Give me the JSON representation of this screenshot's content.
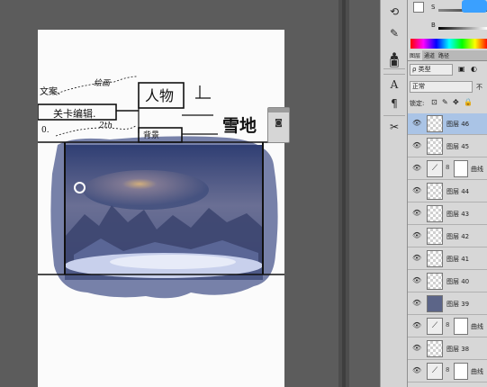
{
  "canvas": {
    "annotations": {
      "wenan": "文案.",
      "huihua": "绘画",
      "renwu": "人物",
      "guanqia": "关卡编辑.",
      "beijing": "背景",
      "o_mark": "0.",
      "num_2": "2th",
      "xuedi": "雪地"
    }
  },
  "toolbar": {
    "icons": [
      "history-icon",
      "brush-presets-icon",
      "clone-source-icon",
      "tool-presets-icon",
      "character-icon",
      "paragraph-icon",
      "tools-icon"
    ]
  },
  "colors": {
    "accent": "#aac4e6",
    "canvas_bg": "#5c5c5c",
    "doc_bg": "#fbfbfb",
    "scene_blue": "#5f6b9a"
  },
  "color_panel": {
    "channel_s_label": "S",
    "channel_b_label": "B"
  },
  "layers_panel": {
    "tabs": [
      "图层",
      "通道",
      "路径"
    ],
    "filter_label": "ρ 类型",
    "blend_mode": "正常",
    "opacity_label": "不",
    "lock_label": "锁定:",
    "layers": [
      {
        "name": "图层 46",
        "kind": "pixel",
        "selected": true
      },
      {
        "name": "图层 45",
        "kind": "pixel"
      },
      {
        "name": "曲线",
        "kind": "adjustment"
      },
      {
        "name": "图层 44",
        "kind": "pixel"
      },
      {
        "name": "图层 43",
        "kind": "pixel"
      },
      {
        "name": "图层 42",
        "kind": "pixel"
      },
      {
        "name": "图层 41",
        "kind": "pixel"
      },
      {
        "name": "图层 40",
        "kind": "pixel"
      },
      {
        "name": "图层 39",
        "kind": "solid"
      },
      {
        "name": "曲线",
        "kind": "adjustment"
      },
      {
        "name": "图层 38",
        "kind": "pixel"
      },
      {
        "name": "曲线",
        "kind": "adjustment"
      }
    ]
  }
}
